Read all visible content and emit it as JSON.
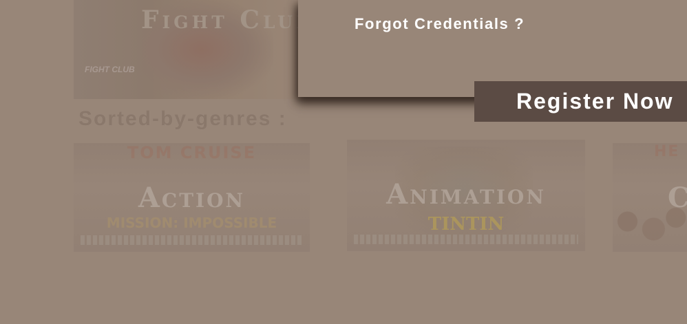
{
  "featured": {
    "title": "Fight Club",
    "logo": "FIGHT CLUB"
  },
  "genres_heading": "Sorted-by-genres :",
  "genres": [
    {
      "label": "Action",
      "top_text": "TOM CRUISE",
      "sub_text": "MISSION: IMPOSSIBLE"
    },
    {
      "label": "Animation",
      "top_text": "",
      "sub_text": "TINTIN"
    },
    {
      "label": "C",
      "top_text": "HE",
      "sub_text": ""
    }
  ],
  "modal": {
    "forgot_link": "Forgot Credentials ?",
    "register_button": "Register Now"
  },
  "colors": {
    "background": "#988678",
    "button": "#5b4b44",
    "text_light": "#ffffff"
  }
}
